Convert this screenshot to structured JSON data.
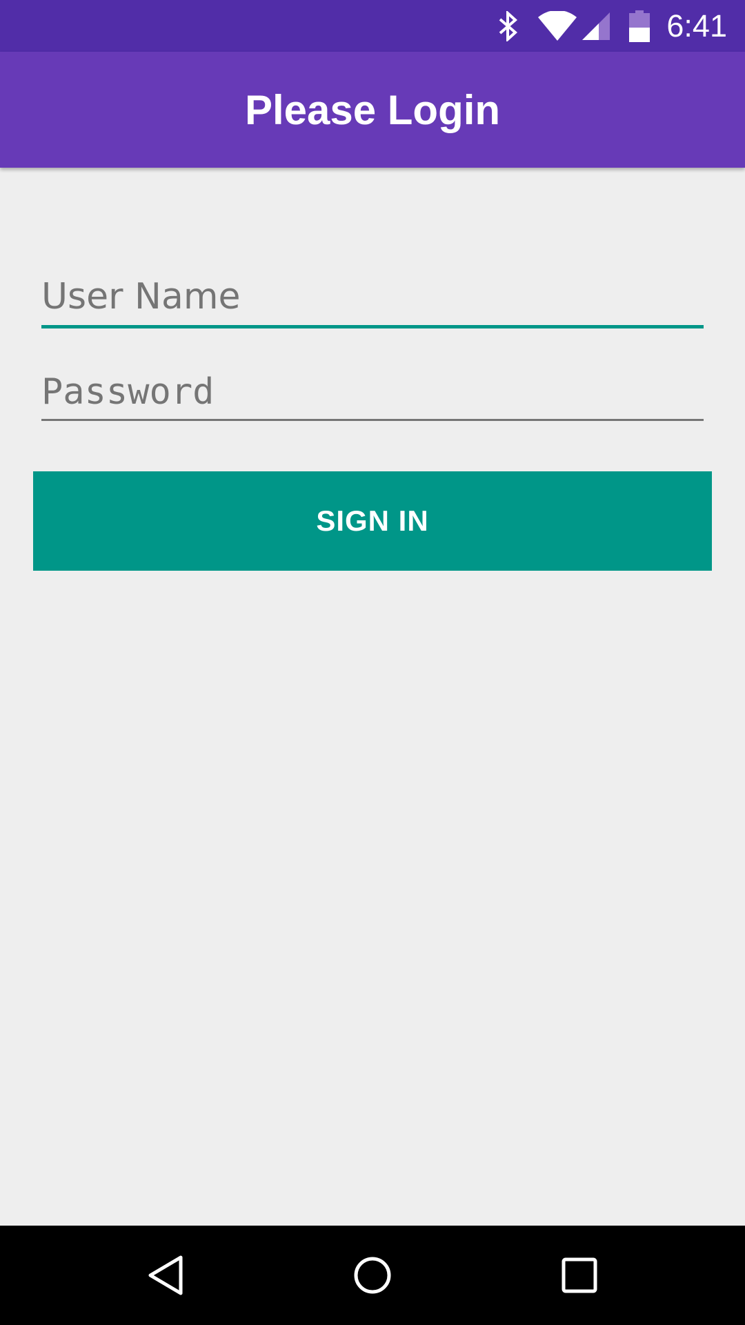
{
  "status_bar": {
    "time": "6:41",
    "icons": [
      "bluetooth-icon",
      "wifi-icon",
      "cell-signal-icon",
      "battery-icon"
    ]
  },
  "app_bar": {
    "title": "Please Login"
  },
  "form": {
    "username": {
      "placeholder": "User Name",
      "value": ""
    },
    "password": {
      "placeholder": "Password",
      "value": ""
    },
    "sign_in_label": "SIGN IN"
  },
  "nav_bar": {
    "buttons": [
      "back-icon",
      "home-icon",
      "recents-icon"
    ]
  },
  "colors": {
    "status_bar": "#512da8",
    "app_bar": "#673ab7",
    "accent": "#009688",
    "background": "#eeeeee",
    "hint_text": "#757575"
  }
}
